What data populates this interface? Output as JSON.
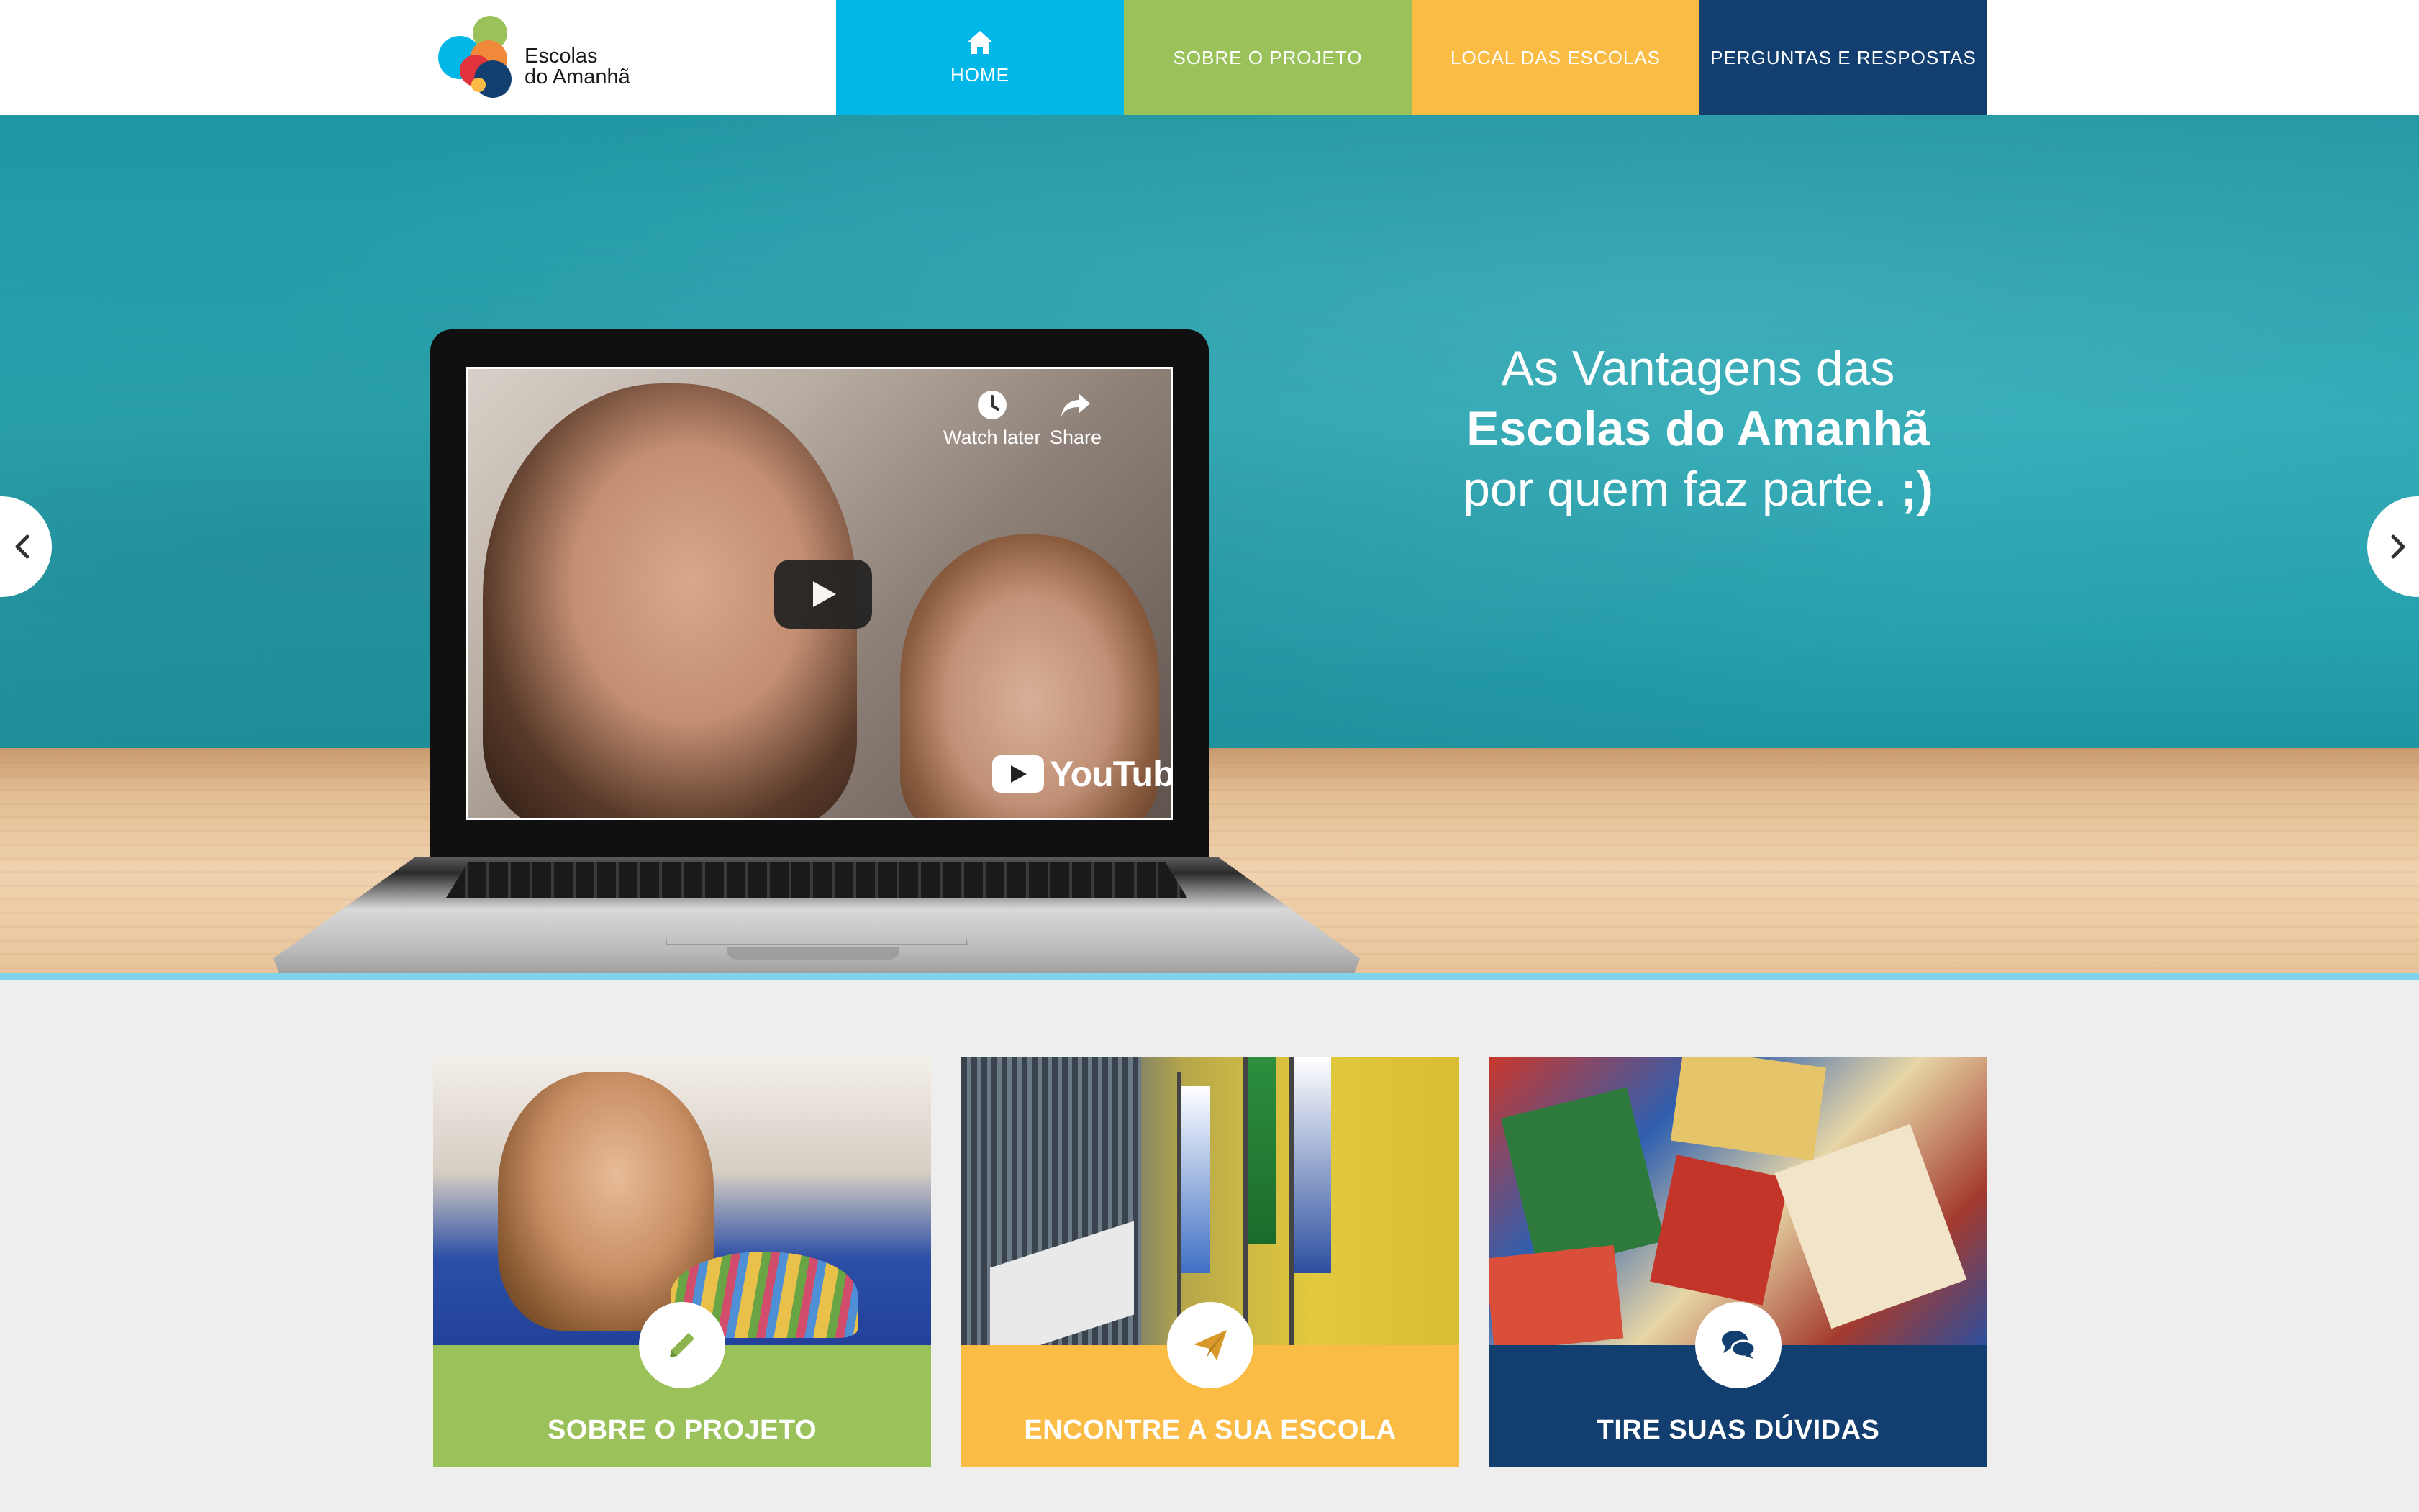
{
  "header": {
    "logo_line1": "Escolas",
    "logo_line2": "do Amanhã",
    "nav": [
      {
        "label": "HOME",
        "color": "#00b7e8",
        "icon": "home-icon",
        "active": true
      },
      {
        "label": "SOBRE O PROJETO",
        "color": "#9bc25a"
      },
      {
        "label": "LOCAL DAS ESCOLAS",
        "color": "#fbbc45"
      },
      {
        "label": "PERGUNTAS E RESPOSTAS",
        "color": "#123f70"
      }
    ]
  },
  "hero": {
    "video": {
      "watch_later": "Watch later",
      "share": "Share",
      "youtube": "YouTube"
    },
    "line1": "As Vantagens das",
    "line2": "Escolas do Amanhã",
    "line3": "por quem faz parte.",
    "line3_wink": ";)",
    "carousel": {
      "slides": 3,
      "active_slide": 2
    }
  },
  "cards": [
    {
      "title": "SOBRE O PROJETO",
      "color": "#9bc25a",
      "icon": "pencil-icon",
      "icon_color": "#9bc25a"
    },
    {
      "title": "ENCONTRE A SUA ESCOLA",
      "color": "#fbbc45",
      "icon": "paper-plane-icon",
      "icon_color": "#e6a634"
    },
    {
      "title": "TIRE SUAS DÚVIDAS",
      "color": "#123f70",
      "icon": "chat-bubbles-icon",
      "icon_color": "#123f70"
    }
  ]
}
